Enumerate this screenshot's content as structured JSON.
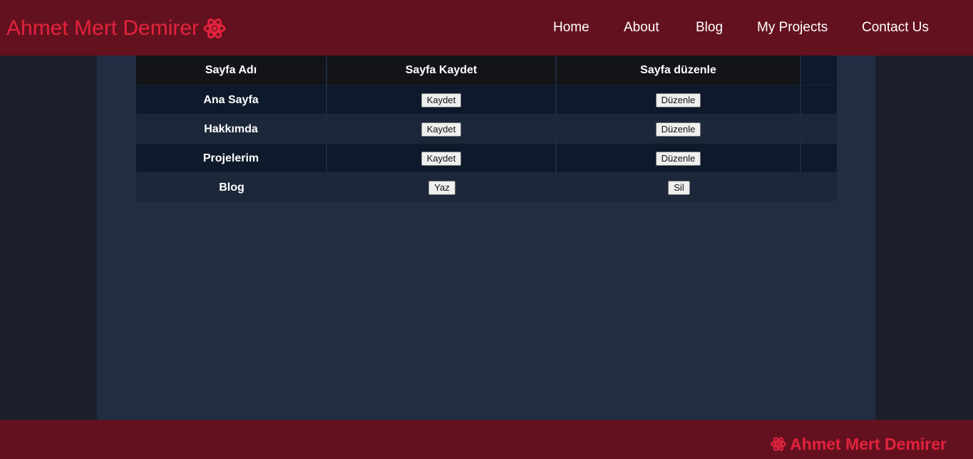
{
  "header": {
    "brand": "Ahmet Mert Demirer",
    "brand_icon": "atom-icon",
    "nav": [
      "Home",
      "About",
      "Blog",
      "My Projects",
      "Contact Us"
    ]
  },
  "table": {
    "headers": [
      "Sayfa Adı",
      "Sayfa Kaydet",
      "Sayfa düzenle"
    ],
    "rows": [
      {
        "name": "Ana Sayfa",
        "save": "Kaydet",
        "edit": "Düzenle"
      },
      {
        "name": "Hakkımda",
        "save": "Kaydet",
        "edit": "Düzenle"
      },
      {
        "name": "Projelerim",
        "save": "Kaydet",
        "edit": "Düzenle"
      },
      {
        "name": "Blog",
        "save": "Yaz",
        "edit": "Sil"
      }
    ]
  },
  "footer": {
    "brand": "Ahmet Mert Demirer",
    "brand_icon": "atom-icon"
  },
  "colors": {
    "header_bg": "#64111f",
    "brand": "#e2233d",
    "content_bg": "#212d42",
    "page_bg": "#1b202b"
  }
}
